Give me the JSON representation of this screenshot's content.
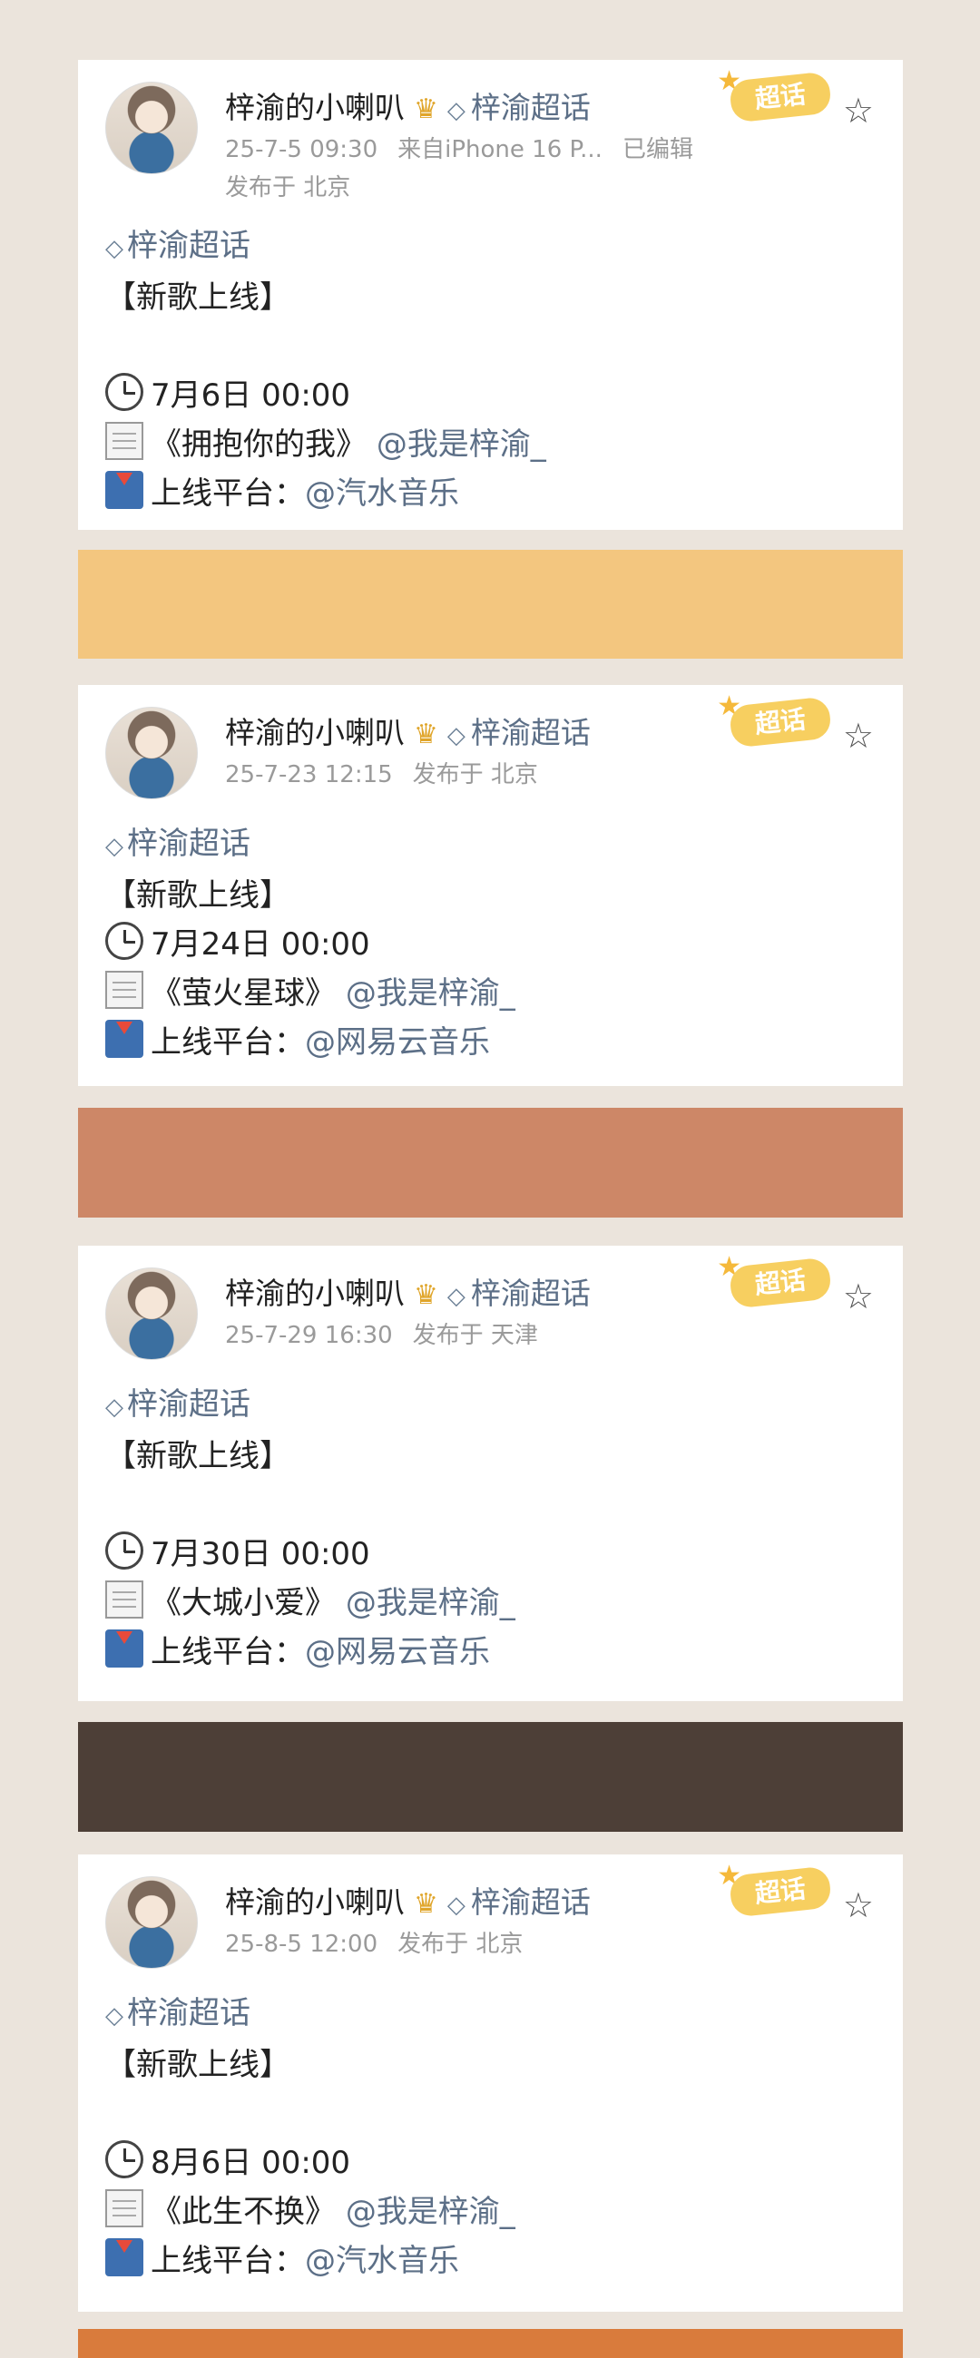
{
  "colors": {
    "page_bg": "#ebe4dc",
    "band1": "#f3c67f",
    "band2": "#cd8767",
    "band3": "#4d3f37",
    "band4": "#d97b3c",
    "link": "#5c6f87"
  },
  "posts": [
    {
      "username": "梓渝的小喇叭",
      "super_topic": "梓渝超话",
      "time": "25-7-5 09:30",
      "source": "来自iPhone 16 P...",
      "edited": "已编辑",
      "location": "发布于 北京",
      "badge": "超话",
      "topic_tag": "梓渝超话",
      "headline": "【新歌上线】",
      "datetime": "7月6日 00:00",
      "song": "《拥抱你的我》",
      "artist": "@我是梓渝_",
      "platform_label": "上线平台：",
      "platform": "@汽水音乐"
    },
    {
      "username": "梓渝的小喇叭",
      "super_topic": "梓渝超话",
      "time": "25-7-23 12:15",
      "location": "发布于 北京",
      "badge": "超话",
      "topic_tag": "梓渝超话",
      "headline": "【新歌上线】",
      "datetime": "7月24日 00:00",
      "song": "《萤火星球》",
      "artist": "@我是梓渝_",
      "platform_label": "上线平台：",
      "platform": "@网易云音乐"
    },
    {
      "username": "梓渝的小喇叭",
      "super_topic": "梓渝超话",
      "time": "25-7-29 16:30",
      "location": "发布于 天津",
      "badge": "超话",
      "topic_tag": "梓渝超话",
      "headline": "【新歌上线】",
      "datetime": "7月30日 00:00",
      "song": "《大城小爱》",
      "artist": "@我是梓渝_",
      "platform_label": "上线平台：",
      "platform": "@网易云音乐"
    },
    {
      "username": "梓渝的小喇叭",
      "super_topic": "梓渝超话",
      "time": "25-8-5 12:00",
      "location": "发布于 北京",
      "badge": "超话",
      "topic_tag": "梓渝超话",
      "headline": "【新歌上线】",
      "datetime": "8月6日 00:00",
      "song": "《此生不换》",
      "artist": "@我是梓渝_",
      "platform_label": "上线平台：",
      "platform": "@汽水音乐"
    }
  ]
}
